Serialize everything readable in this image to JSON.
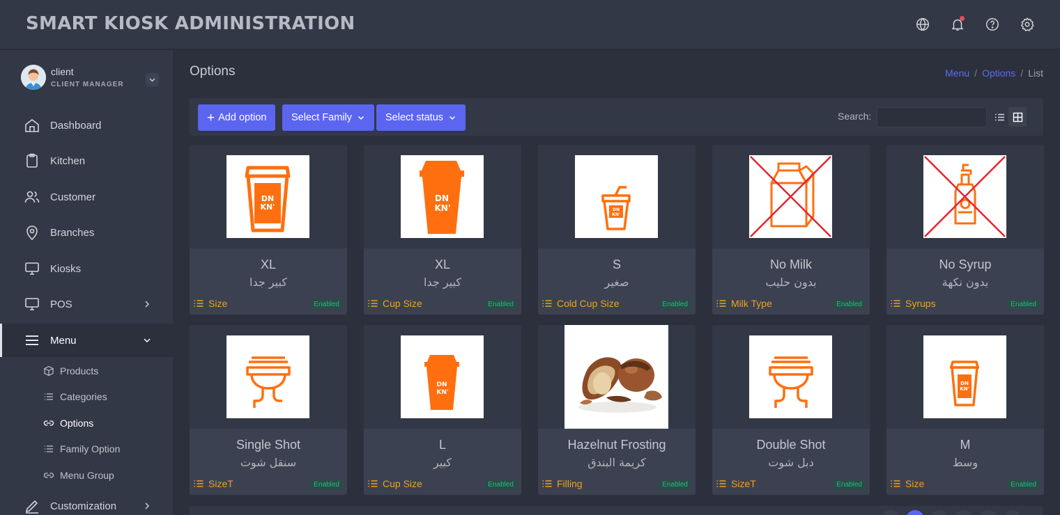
{
  "app": {
    "title": "SMART KIOSK ADMINISTRATION"
  },
  "topbar": {
    "icons": [
      "globe-icon",
      "bell-icon",
      "help-icon",
      "gear-icon"
    ]
  },
  "user": {
    "name": "client",
    "role": "CLIENT MANAGER"
  },
  "sidebar": {
    "items": [
      {
        "label": "Dashboard",
        "icon": "home-icon"
      },
      {
        "label": "Kitchen",
        "icon": "clipboard-icon"
      },
      {
        "label": "Customer",
        "icon": "users-icon"
      },
      {
        "label": "Branches",
        "icon": "map-pin-icon"
      },
      {
        "label": "Kiosks",
        "icon": "monitor-icon"
      },
      {
        "label": "POS",
        "icon": "monitor-icon"
      },
      {
        "label": "Menu",
        "icon": "menu-icon"
      },
      {
        "label": "Customization",
        "icon": "pen-icon"
      }
    ],
    "menu_sub": [
      {
        "label": "Products",
        "icon": "box-icon"
      },
      {
        "label": "Categories",
        "icon": "list-icon"
      },
      {
        "label": "Options",
        "icon": "link-icon"
      },
      {
        "label": "Family Option",
        "icon": "list-icon"
      },
      {
        "label": "Menu Group",
        "icon": "link-icon"
      }
    ]
  },
  "page": {
    "title": "Options",
    "breadcrumb": [
      "Menu",
      "Options",
      "List"
    ]
  },
  "toolbar": {
    "add_label": "Add option",
    "family_label": "Select Family",
    "status_label": "Select status",
    "search_label": "Search:",
    "search_placeholder": ""
  },
  "cards": [
    {
      "name": "XL",
      "ar": "كبير جدا",
      "family": "Size",
      "status": "Enabled",
      "image": "cup-outline-icon"
    },
    {
      "name": "XL",
      "ar": "كبير جدا",
      "family": "Cup Size",
      "status": "Enabled",
      "image": "cup-filled-icon"
    },
    {
      "name": "S",
      "ar": "صغير",
      "family": "Cold Cup Size",
      "status": "Enabled",
      "image": "cold-cup-icon"
    },
    {
      "name": "No Milk",
      "ar": "بدون حليب",
      "family": "Milk Type",
      "status": "Enabled",
      "image": "no-milk-icon"
    },
    {
      "name": "No Syrup",
      "ar": "بدون نكهة",
      "family": "Syrups",
      "status": "Enabled",
      "image": "no-syrup-icon"
    },
    {
      "name": "Single Shot",
      "ar": "سنقل شوت",
      "family": "SizeT",
      "status": "Enabled",
      "image": "espresso-shot-icon"
    },
    {
      "name": "L",
      "ar": "كبير",
      "family": "Cup Size",
      "status": "Enabled",
      "image": "cup-filled-icon"
    },
    {
      "name": "Hazelnut Frosting",
      "ar": "كريمة البندق",
      "family": "Filling",
      "status": "Enabled",
      "image": "hazelnut-photo"
    },
    {
      "name": "Double Shot",
      "ar": "دبل شوت",
      "family": "SizeT",
      "status": "Enabled",
      "image": "espresso-shot-icon"
    },
    {
      "name": "M",
      "ar": "وسط",
      "family": "Size",
      "status": "Enabled",
      "image": "cup-outline-icon"
    }
  ],
  "colors": {
    "accent": "#5b65f0",
    "orange": "#ff6f0f",
    "family": "#f0a21f",
    "enabled": "#1fbb82",
    "cross": "#e8222d"
  }
}
